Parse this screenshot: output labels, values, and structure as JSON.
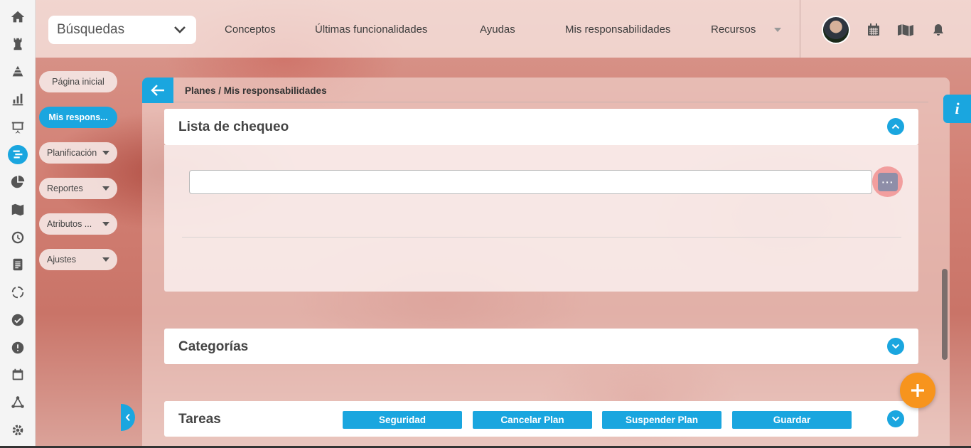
{
  "topbar": {
    "search_label": "Búsquedas",
    "nav": [
      "Conceptos",
      "Últimas funcionalidades",
      "Ayudas",
      "Mis responsabilidades",
      "Recursos"
    ]
  },
  "rail_icons": [
    "home-icon",
    "chess-rook-icon",
    "pyramid-icon",
    "bar-chart-icon",
    "presentation-icon",
    "plans-icon",
    "pie-chart-icon",
    "map-icon",
    "clock-icon",
    "document-icon",
    "cycle-icon",
    "check-circle-icon",
    "warning-icon",
    "calendar-icon",
    "network-icon",
    "gear-icon"
  ],
  "submenu": {
    "items": [
      {
        "label": "Página inicial",
        "active": false,
        "dropdown": false
      },
      {
        "label": "Mis respons...",
        "active": true,
        "dropdown": false
      },
      {
        "label": "Planificación",
        "active": false,
        "dropdown": true
      },
      {
        "label": "Reportes",
        "active": false,
        "dropdown": true
      },
      {
        "label": "Atributos ...",
        "active": false,
        "dropdown": true
      },
      {
        "label": "Ajustes",
        "active": false,
        "dropdown": true
      }
    ]
  },
  "breadcrumb": "Planes / Mis responsabilidades",
  "sections": {
    "checklist": {
      "title": "Lista de chequeo",
      "input_value": "",
      "more_label": "···"
    },
    "categories": {
      "title": "Categorías"
    },
    "tasks": {
      "title": "Tareas"
    }
  },
  "actions": [
    "Seguridad",
    "Cancelar Plan",
    "Suspender Plan",
    "Guardar"
  ],
  "info_label": "i",
  "colors": {
    "accent": "#1aa6df",
    "fab": "#f7941d",
    "more_button": "#8e8ea8"
  }
}
